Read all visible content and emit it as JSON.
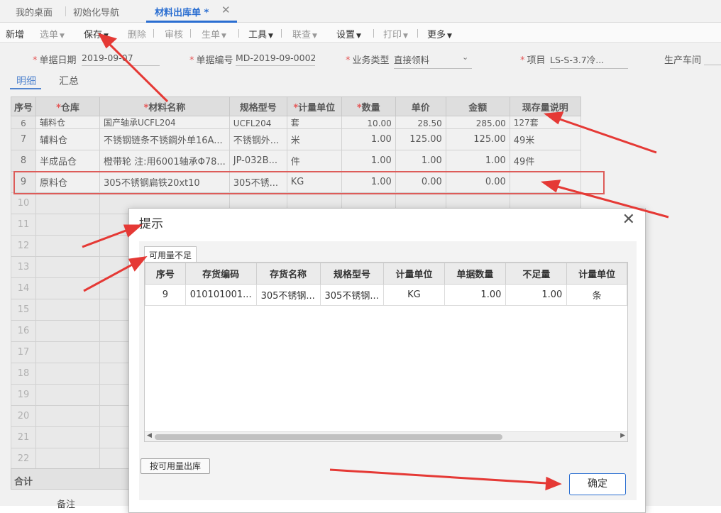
{
  "tabs": [
    {
      "label": "我的桌面"
    },
    {
      "label": "初始化导航"
    },
    {
      "label": "材料出库单 *"
    }
  ],
  "toolbar": [
    {
      "label": "新增",
      "caret": false,
      "disabled": false
    },
    {
      "label": "选单",
      "caret": true,
      "disabled": true
    },
    {
      "label": "保存",
      "caret": true,
      "disabled": false
    },
    {
      "label": "删除",
      "caret": false,
      "disabled": true
    },
    {
      "label": "审核",
      "caret": false,
      "disabled": true
    },
    {
      "label": "生单",
      "caret": true,
      "disabled": true
    },
    {
      "label": "工具",
      "caret": true,
      "disabled": false
    },
    {
      "label": "联查",
      "caret": true,
      "disabled": true
    },
    {
      "label": "设置",
      "caret": true,
      "disabled": false
    },
    {
      "label": "打印",
      "caret": true,
      "disabled": true
    },
    {
      "label": "更多",
      "caret": true,
      "disabled": false
    }
  ],
  "form": {
    "date_label": "单据日期",
    "date_value": "2019-09-07",
    "code_label": "单据编号",
    "code_value": "MD-2019-09-0002",
    "biztype_label": "业务类型",
    "biztype_value": "直接领料",
    "project_label": "项目",
    "project_value": "LS-S-3.7冷...",
    "workshop_label": "生产车间"
  },
  "detail_tabs": {
    "detail": "明细",
    "summary": "汇总"
  },
  "grid": {
    "headers": [
      "序号",
      "仓库",
      "材料名称",
      "规格型号",
      "计量单位",
      "数量",
      "单价",
      "金额",
      "现存量说明"
    ],
    "partial_row": [
      "6",
      "辅料仓",
      "国产轴承UCFL204",
      "UCFL204",
      "套",
      "10.00",
      "28.50",
      "285.00",
      "127套"
    ],
    "rows": [
      [
        "7",
        "辅料仓",
        "不锈钢链条不锈鋼外单16A...",
        "不锈钢外...",
        "米",
        "1.00",
        "125.00",
        "125.00",
        "49米"
      ],
      [
        "8",
        "半成品仓",
        "橙带轮 注:用6001轴承Φ78...",
        "JP-032B...",
        "件",
        "1.00",
        "1.00",
        "1.00",
        "49件"
      ],
      [
        "9",
        "原料仓",
        "305不锈钢扁铁20xt10",
        "305不锈...",
        "KG",
        "1.00",
        "0.00",
        "0.00",
        ""
      ]
    ],
    "empty_rows": [
      "10",
      "11",
      "12",
      "13",
      "14",
      "15",
      "16",
      "17",
      "18",
      "19",
      "20",
      "21",
      "22"
    ],
    "sum_label": "合计",
    "remark_label": "备注"
  },
  "dialog": {
    "title": "提示",
    "subtab": "可用量不足",
    "headers": [
      "序号",
      "存货编码",
      "存货名称",
      "规格型号",
      "计量单位",
      "单据数量",
      "不足量",
      "计量单位"
    ],
    "rows": [
      [
        "9",
        "010101001...",
        "305不锈钢...",
        "305不锈钢...",
        "KG",
        "1.00",
        "1.00",
        "条"
      ]
    ],
    "btn_avail": "按可用量出库",
    "btn_ok": "确定"
  },
  "colors": {
    "accent": "#2a6ed1",
    "annotation_red": "#e53935",
    "required": "#e33333"
  }
}
